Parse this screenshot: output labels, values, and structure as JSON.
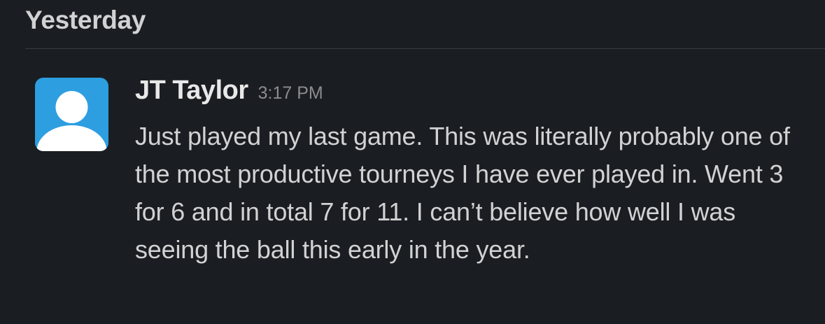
{
  "day_divider": {
    "label": "Yesterday"
  },
  "message": {
    "author": "JT Taylor",
    "time": "3:17 PM",
    "avatar_icon": "default-user-avatar-icon",
    "avatar_color": "#2d9ee0",
    "text": "Just played my last game. This was literally probably one of the most productive tourneys I have ever played in. Went 3 for 6 and in total 7 for 11. I can’t believe how well I was seeing the ball this early in the year."
  }
}
